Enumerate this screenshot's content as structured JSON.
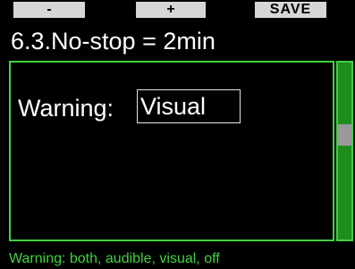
{
  "softkeys": {
    "left_label": "-",
    "center_label": "+",
    "right_label": "SAVE"
  },
  "screen": {
    "title": "6.3.No-stop = 2min"
  },
  "setting": {
    "label": "Warning:",
    "value": "Visual"
  },
  "scrollbar": {
    "thumb_start_fraction": 0.35,
    "thumb_end_fraction": 0.47
  },
  "help": {
    "text": "Warning: both, audible, visual, off"
  },
  "colors": {
    "accent_green": "#3fd23f",
    "scrollbar_track": "#1e8d1e",
    "softkey_bg": "#d6d6d6",
    "background": "#000000"
  }
}
